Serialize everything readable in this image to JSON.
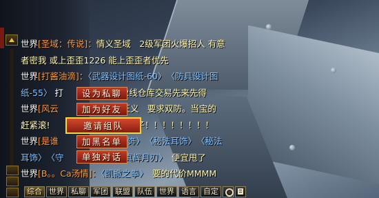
{
  "chat": {
    "lines": [
      {
        "channel": "世界",
        "name": "[圣域：传说]",
        "sep": "：",
        "parts": [
          {
            "t": "情义圣域　2级军团火爆招人 有意",
            "c": "msg-y"
          }
        ]
      },
      {
        "channel": "",
        "name": "",
        "sep": "",
        "parts": [
          {
            "t": "者密我 或上歪歪1226 能上歪歪者优先",
            "c": "msg-y"
          }
        ]
      },
      {
        "channel": "世界",
        "name": "[打酱油滴]",
        "sep": "：",
        "parts": [
          {
            "t": "〈武器设计图纸-60〉",
            "c": "link"
          },
          {
            "t": "　",
            "c": "msg-w"
          },
          {
            "t": "〈防具设计图",
            "c": "link"
          }
        ]
      },
      {
        "channel": "",
        "name": "",
        "sep": "",
        "parts": [
          {
            "t": "纸-55〉",
            "c": "link"
          },
          {
            "t": " 打",
            "c": "msg-w"
          },
          {
            "t": "　　　　　　",
            "c": "msg-w"
          },
          {
            "t": "度2线仓库交易先来先得",
            "c": "msg-y"
          }
        ]
      },
      {
        "channel": "世界",
        "name": "[风云",
        "sep": "",
        "parts": [
          {
            "t": "　　　　　　",
            "c": "msg-w"
          },
          {
            "t": "历 正义　要求双防。当宝的",
            "c": "msg-y"
          }
        ]
      },
      {
        "channel": "",
        "name": "",
        "sep": "",
        "parts": [
          {
            "t": "赶紧滚!",
            "c": "msg-y"
          },
          {
            "t": "　　　　　　　　　",
            "c": "msg-w"
          },
          {
            "t": "鞋子！！！！！！！！",
            "c": "msg-y"
          }
        ]
      },
      {
        "channel": "世界",
        "name": "[是谁",
        "sep": "",
        "parts": [
          {
            "t": "　　　　　　　",
            "c": "msg-w"
          },
          {
            "t": "耳饰〉",
            "c": "link"
          },
          {
            "t": "　",
            "c": "msg-w"
          },
          {
            "t": "〈秘法耳饰〉",
            "c": "link"
          },
          {
            "t": "　",
            "c": "msg-w"
          },
          {
            "t": "〈秘法",
            "c": "link"
          }
        ]
      },
      {
        "channel": "",
        "name": "",
        "sep": "",
        "parts": [
          {
            "t": "耳饰〉",
            "c": "link"
          },
          {
            "t": "　",
            "c": "msg-w"
          },
          {
            "t": "〈守",
            "c": "link"
          },
          {
            "t": "　　　　　　　",
            "c": "msg-w"
          },
          {
            "t": "真辉月刃〉",
            "c": "link"
          },
          {
            "t": "　便宜甩了",
            "c": "msg-y"
          }
        ]
      },
      {
        "channel": "世界",
        "name": "[B。。Ca汤情]",
        "sep": "：",
        "parts": [
          {
            "t": "〈凯撒之拳〉",
            "c": "link"
          },
          {
            "t": "　要的代价MMMM",
            "c": "msg-y"
          }
        ]
      }
    ]
  },
  "context_menu": {
    "items": [
      {
        "label": "设为私聊",
        "selected": false
      },
      {
        "label": "加为好友",
        "selected": false
      },
      {
        "label": "邀请组队",
        "selected": true
      },
      {
        "label": "加黑名单",
        "selected": false
      },
      {
        "label": "单独对话",
        "selected": false
      }
    ]
  },
  "tabs": [
    {
      "label": "综合",
      "active": true
    },
    {
      "label": "世界",
      "active": false
    },
    {
      "label": "私聊",
      "active": false
    },
    {
      "label": "军团",
      "active": false
    },
    {
      "label": "联盟",
      "active": false
    },
    {
      "label": "队伍",
      "active": false
    },
    {
      "label": "世界",
      "active": false
    },
    {
      "label": "语言",
      "active": false
    },
    {
      "label": "自定",
      "active": false
    }
  ],
  "icons": {
    "settings": "gear-icon",
    "notepad": "notepad-icon",
    "scroll_up": "arrow-up-icon",
    "scroll_down": "arrow-down-icon",
    "scroll_top": "double-arrow-up-icon"
  },
  "colors": {
    "channel_text": "#ffffff",
    "player_name": "#ff9a3c",
    "item_link": "#7ec2ff",
    "message_text": "#fff5b0",
    "menu_bg": "#a32a1a",
    "menu_selected_border": "#f5d83a"
  }
}
